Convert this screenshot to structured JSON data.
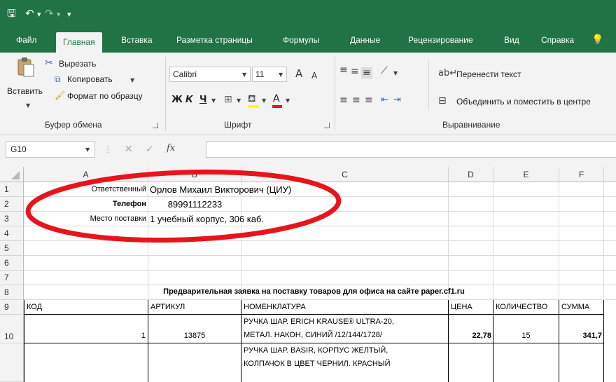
{
  "ribbon_tabs": [
    "Файл",
    "Главная",
    "Вставка",
    "Разметка страницы",
    "Формулы",
    "Данные",
    "Рецензирование",
    "Вид",
    "Справка"
  ],
  "clipboard": {
    "paste": "Вставить",
    "cut": "Вырезать",
    "copy": "Копировать",
    "format_painter": "Формат по образцу",
    "group": "Буфер обмена"
  },
  "font": {
    "name": "Calibri",
    "size": "11",
    "bold": "Ж",
    "italic": "К",
    "underline": "Ч",
    "grow": "A",
    "shrink": "A",
    "group": "Шрифт"
  },
  "alignment": {
    "wrap_text": "Перенести текст",
    "merge_center": "Объединить и поместить в центре",
    "group": "Выравнивание"
  },
  "formula_bar": {
    "name_box": "G10",
    "fx": "fx",
    "formula": ""
  },
  "colors": {
    "excel_green": "#217346",
    "ribbon_bg": "#f3f3f3",
    "annotation_red": "#e8141c"
  },
  "columns": [
    "A",
    "B",
    "C",
    "D",
    "E",
    "F"
  ],
  "rows": [
    "1",
    "2",
    "3",
    "4",
    "5",
    "6",
    "7",
    "8",
    "9",
    "10",
    ""
  ],
  "cells": {
    "A1": "Ответственный",
    "B1": "Орлов Михаил Викторович (ЦИУ)",
    "A2": "Телефон",
    "B2": "89991112233",
    "A3": "Место поставки",
    "B3": "1 учебный корпус, 306 каб.",
    "title7": "Предварительная заявка на поставку товаров для офиса на сайте paper.cf1.ru",
    "A9": "КОД",
    "B9": "АРТИКУЛ",
    "C9": "НОМЕНКЛАТУРА",
    "D9": "ЦЕНА",
    "E9": "КОЛИЧЕСТВО",
    "F9": "СУММА",
    "A10": "1",
    "B10": "13875",
    "C10_line1": "РУЧКА ШАР. ERICH KRAUSE® ULTRA-20,",
    "C10_line2": "МЕТАЛ. НАКОН, СИНИЙ /12/144/1728/",
    "D10": "22,78",
    "E10": "15",
    "F10": "341,7",
    "C11_line1": "РУЧКА ШАР. BASIR, КОРПУС ЖЕЛТЫЙ,",
    "C11_line2": "КОЛПАЧОК В ЦВЕТ ЧЕРНИЛ. КРАСНЫЙ"
  }
}
